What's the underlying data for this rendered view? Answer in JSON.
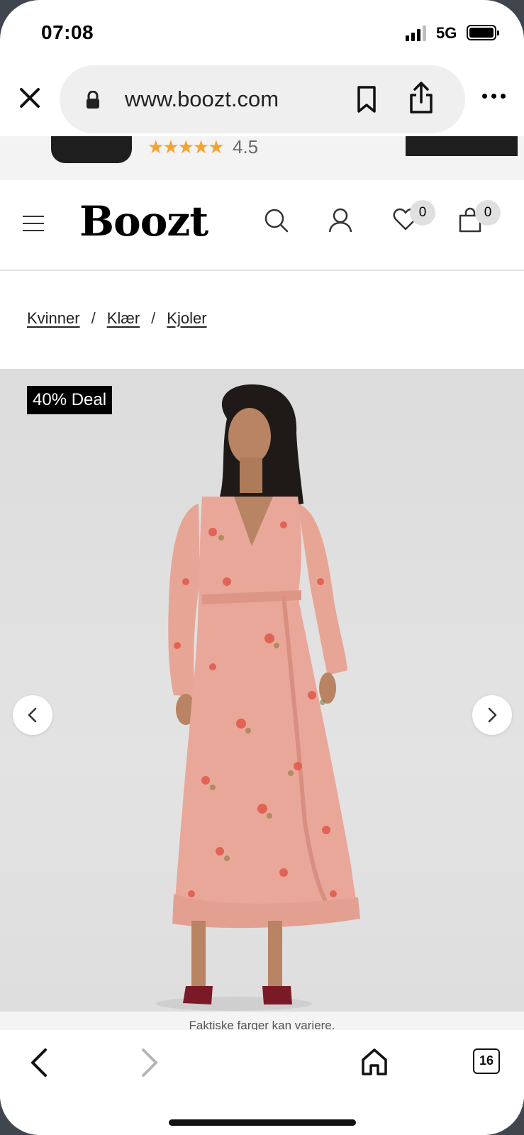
{
  "status_bar": {
    "time": "07:08",
    "network": "5G"
  },
  "browser": {
    "url": "www.boozt.com",
    "tabs_count": "16"
  },
  "app_banner": {
    "stars": "★★★★★",
    "rating": "4.5"
  },
  "header": {
    "logo": "Boozt",
    "wishlist_count": "0",
    "cart_count": "0"
  },
  "breadcrumb": [
    {
      "label": "Kvinner"
    },
    {
      "label": "Klær"
    },
    {
      "label": "Kjoler"
    }
  ],
  "product": {
    "deal_badge": "40% Deal",
    "disclaimer": "Faktiske farger kan variere."
  },
  "colors": {
    "background": "#ffffff",
    "image_bg": "#dcdcdc",
    "star": "#f3a330",
    "badge_bg": "#000000",
    "dress": "#e9a79a"
  }
}
